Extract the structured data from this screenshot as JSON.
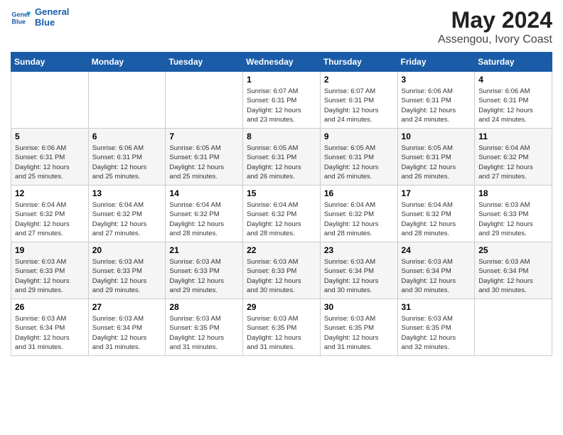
{
  "logo": {
    "line1": "General",
    "line2": "Blue"
  },
  "title": "May 2024",
  "subtitle": "Assengou, Ivory Coast",
  "weekdays": [
    "Sunday",
    "Monday",
    "Tuesday",
    "Wednesday",
    "Thursday",
    "Friday",
    "Saturday"
  ],
  "weeks": [
    [
      {
        "day": "",
        "info": ""
      },
      {
        "day": "",
        "info": ""
      },
      {
        "day": "",
        "info": ""
      },
      {
        "day": "1",
        "info": "Sunrise: 6:07 AM\nSunset: 6:31 PM\nDaylight: 12 hours\nand 23 minutes."
      },
      {
        "day": "2",
        "info": "Sunrise: 6:07 AM\nSunset: 6:31 PM\nDaylight: 12 hours\nand 24 minutes."
      },
      {
        "day": "3",
        "info": "Sunrise: 6:06 AM\nSunset: 6:31 PM\nDaylight: 12 hours\nand 24 minutes."
      },
      {
        "day": "4",
        "info": "Sunrise: 6:06 AM\nSunset: 6:31 PM\nDaylight: 12 hours\nand 24 minutes."
      }
    ],
    [
      {
        "day": "5",
        "info": "Sunrise: 6:06 AM\nSunset: 6:31 PM\nDaylight: 12 hours\nand 25 minutes."
      },
      {
        "day": "6",
        "info": "Sunrise: 6:06 AM\nSunset: 6:31 PM\nDaylight: 12 hours\nand 25 minutes."
      },
      {
        "day": "7",
        "info": "Sunrise: 6:05 AM\nSunset: 6:31 PM\nDaylight: 12 hours\nand 25 minutes."
      },
      {
        "day": "8",
        "info": "Sunrise: 6:05 AM\nSunset: 6:31 PM\nDaylight: 12 hours\nand 26 minutes."
      },
      {
        "day": "9",
        "info": "Sunrise: 6:05 AM\nSunset: 6:31 PM\nDaylight: 12 hours\nand 26 minutes."
      },
      {
        "day": "10",
        "info": "Sunrise: 6:05 AM\nSunset: 6:31 PM\nDaylight: 12 hours\nand 26 minutes."
      },
      {
        "day": "11",
        "info": "Sunrise: 6:04 AM\nSunset: 6:32 PM\nDaylight: 12 hours\nand 27 minutes."
      }
    ],
    [
      {
        "day": "12",
        "info": "Sunrise: 6:04 AM\nSunset: 6:32 PM\nDaylight: 12 hours\nand 27 minutes."
      },
      {
        "day": "13",
        "info": "Sunrise: 6:04 AM\nSunset: 6:32 PM\nDaylight: 12 hours\nand 27 minutes."
      },
      {
        "day": "14",
        "info": "Sunrise: 6:04 AM\nSunset: 6:32 PM\nDaylight: 12 hours\nand 28 minutes."
      },
      {
        "day": "15",
        "info": "Sunrise: 6:04 AM\nSunset: 6:32 PM\nDaylight: 12 hours\nand 28 minutes."
      },
      {
        "day": "16",
        "info": "Sunrise: 6:04 AM\nSunset: 6:32 PM\nDaylight: 12 hours\nand 28 minutes."
      },
      {
        "day": "17",
        "info": "Sunrise: 6:04 AM\nSunset: 6:32 PM\nDaylight: 12 hours\nand 28 minutes."
      },
      {
        "day": "18",
        "info": "Sunrise: 6:03 AM\nSunset: 6:33 PM\nDaylight: 12 hours\nand 29 minutes."
      }
    ],
    [
      {
        "day": "19",
        "info": "Sunrise: 6:03 AM\nSunset: 6:33 PM\nDaylight: 12 hours\nand 29 minutes."
      },
      {
        "day": "20",
        "info": "Sunrise: 6:03 AM\nSunset: 6:33 PM\nDaylight: 12 hours\nand 29 minutes."
      },
      {
        "day": "21",
        "info": "Sunrise: 6:03 AM\nSunset: 6:33 PM\nDaylight: 12 hours\nand 29 minutes."
      },
      {
        "day": "22",
        "info": "Sunrise: 6:03 AM\nSunset: 6:33 PM\nDaylight: 12 hours\nand 30 minutes."
      },
      {
        "day": "23",
        "info": "Sunrise: 6:03 AM\nSunset: 6:34 PM\nDaylight: 12 hours\nand 30 minutes."
      },
      {
        "day": "24",
        "info": "Sunrise: 6:03 AM\nSunset: 6:34 PM\nDaylight: 12 hours\nand 30 minutes."
      },
      {
        "day": "25",
        "info": "Sunrise: 6:03 AM\nSunset: 6:34 PM\nDaylight: 12 hours\nand 30 minutes."
      }
    ],
    [
      {
        "day": "26",
        "info": "Sunrise: 6:03 AM\nSunset: 6:34 PM\nDaylight: 12 hours\nand 31 minutes."
      },
      {
        "day": "27",
        "info": "Sunrise: 6:03 AM\nSunset: 6:34 PM\nDaylight: 12 hours\nand 31 minutes."
      },
      {
        "day": "28",
        "info": "Sunrise: 6:03 AM\nSunset: 6:35 PM\nDaylight: 12 hours\nand 31 minutes."
      },
      {
        "day": "29",
        "info": "Sunrise: 6:03 AM\nSunset: 6:35 PM\nDaylight: 12 hours\nand 31 minutes."
      },
      {
        "day": "30",
        "info": "Sunrise: 6:03 AM\nSunset: 6:35 PM\nDaylight: 12 hours\nand 31 minutes."
      },
      {
        "day": "31",
        "info": "Sunrise: 6:03 AM\nSunset: 6:35 PM\nDaylight: 12 hours\nand 32 minutes."
      },
      {
        "day": "",
        "info": ""
      }
    ]
  ]
}
